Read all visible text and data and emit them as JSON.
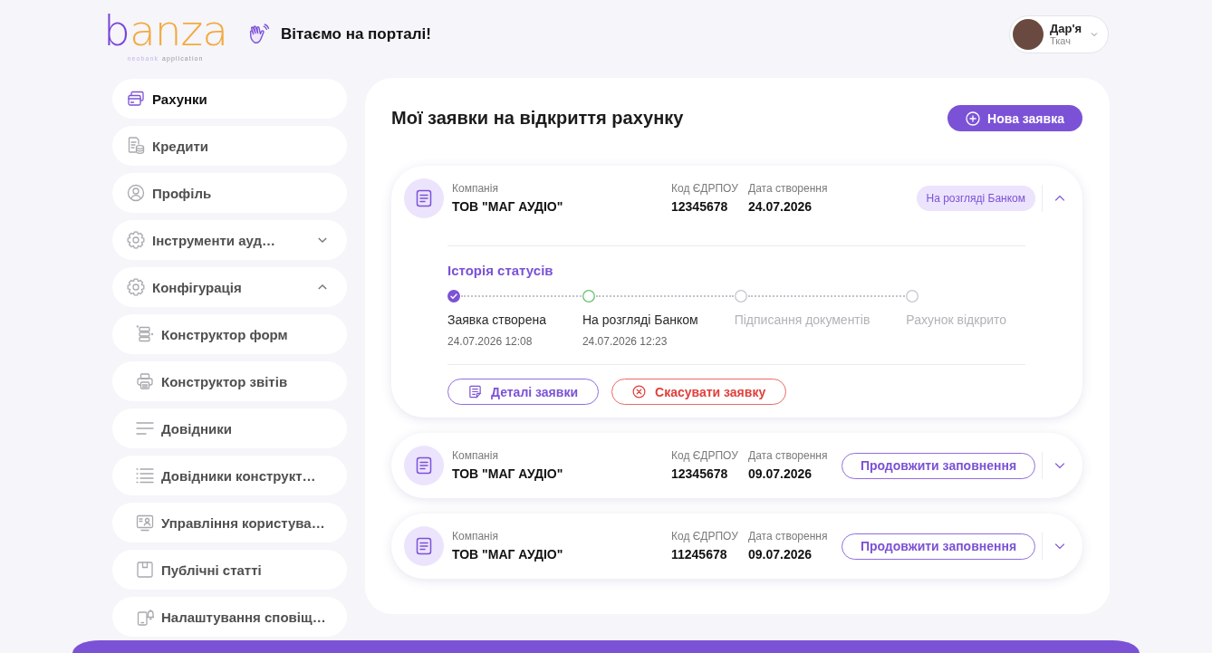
{
  "header": {
    "logo": {
      "wordmark": "banza",
      "tagline_brand": "neobank",
      "tagline_rest": "application"
    },
    "greeting": "Вітаємо на порталі!",
    "user": {
      "first_name": "Дар'я",
      "last_name": "Ткач"
    }
  },
  "sidebar": {
    "items": [
      {
        "label": "Рахунки",
        "selected": true
      },
      {
        "label": "Кредити",
        "selected": false
      },
      {
        "label": "Профіль",
        "selected": false
      },
      {
        "label": "Інструменти ауд…",
        "selected": false,
        "expanded": false
      },
      {
        "label": "Конфігурація",
        "selected": false,
        "expanded": true,
        "children": [
          {
            "label": "Конструктор форм",
            "selected": false
          },
          {
            "label": "Конструктор звітів",
            "selected": false
          },
          {
            "label": "Довідники",
            "selected": false
          },
          {
            "label": "Довідники конструкт…",
            "selected": false
          },
          {
            "label": "Управління користува…",
            "selected": false
          },
          {
            "label": "Публічні статті",
            "selected": false
          },
          {
            "label": "Налаштування сповіщ…",
            "selected": false
          }
        ]
      }
    ]
  },
  "main": {
    "title": "Мої заявки на відкриття рахунку",
    "new_button": "Нова заявка",
    "applications": [
      {
        "expanded": true,
        "company_label": "Компанія",
        "company": "ТОВ \"МАГ АУДІО\"",
        "code_label": "Код ЄДРПОУ",
        "code": "12345678",
        "date_label": "Дата створення",
        "date": "24.07.2026",
        "status": "На розгляді Банком",
        "history_title": "Історія статусів",
        "history": [
          {
            "label": "Заявка створена",
            "date": "24.07.2026 12:08",
            "done": true,
            "current": false
          },
          {
            "label": "На розгляді Банком",
            "date": "24.07.2026 12:23",
            "done": false,
            "current": true
          },
          {
            "label": "Підписання документів",
            "done": false,
            "current": false
          },
          {
            "label": "Рахунок відкрито",
            "done": false,
            "current": false
          }
        ],
        "actions": [
          {
            "kind": "details",
            "label": "Деталі заявки"
          },
          {
            "kind": "cancel",
            "label": "Скасувати заявку"
          }
        ]
      },
      {
        "expanded": false,
        "company_label": "Компанія",
        "company": "ТОВ \"МАГ АУДІО\"",
        "code_label": "Код ЄДРПОУ",
        "code": "12345678",
        "date_label": "Дата створення",
        "date": "09.07.2026",
        "action": "Продовжити заповнення"
      },
      {
        "expanded": false,
        "company_label": "Компанія",
        "company": "ТОВ \"МАГ АУДІО\"",
        "code_label": "Код ЄДРПОУ",
        "code": "11245678",
        "date_label": "Дата створення",
        "date": "09.07.2026",
        "action": "Продовжити заповнення"
      }
    ]
  }
}
